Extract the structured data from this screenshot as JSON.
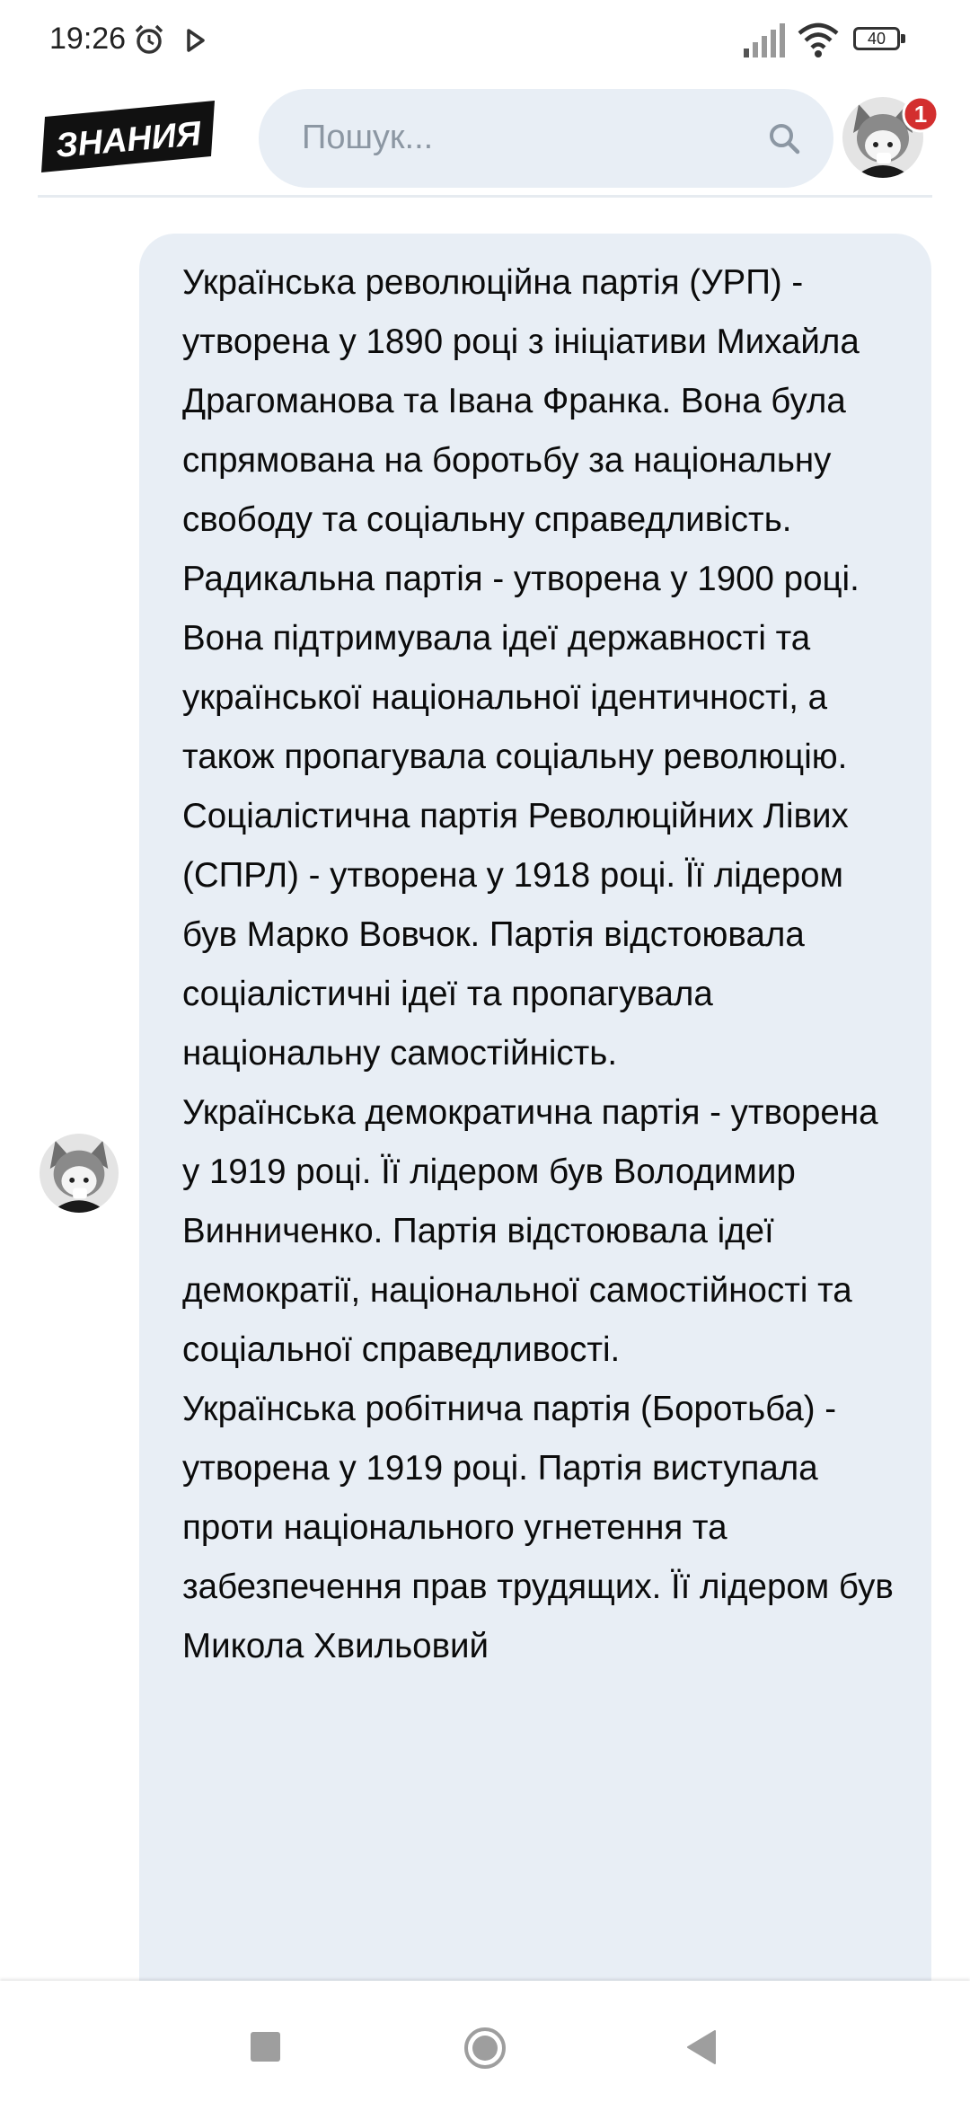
{
  "status_bar": {
    "time": "19:26",
    "battery": "40",
    "icons": [
      "alarm-icon",
      "play-icon",
      "signal-icon",
      "wifi-icon",
      "battery-icon"
    ]
  },
  "header": {
    "logo_text": "ЗНАНИЯ",
    "search": {
      "placeholder": "Пошук...",
      "value": ""
    },
    "notification_count": "1"
  },
  "colors": {
    "bubble_bg": "#e8eef5",
    "badge": "#d32f2f",
    "logo_bg": "#111111"
  },
  "message": {
    "paragraphs": [
      "Українська революційна партія (УРП) - утворена у 1890 році з ініціативи Михайла Драгоманова та Івана Франка. Вона була спрямована на боротьбу за національну свободу та соціальну справедливість.",
      "Радикальна партія - утворена у 1900 році. Вона підтримувала ідеї державності та української національної ідентичності, а також пропагувала соціальну революцію.",
      "Соціалістична партія Революційних Лівих (СПРЛ) - утворена у 1918 році. Її лідером був Марко Вовчок. Партія відстоювала соціалістичні ідеї та пропагувала національну самостійність.",
      "Українська демократична партія - утворена у 1919 році. Її лідером був Володимир Винниченко. Партія відстоювала ідеї демократії, національної самостійності та соціальної справедливості.",
      "Українська робітнича партія (Боротьба) - утворена у 1919 році. Партія виступала проти національного угнетення та забезпечення прав трудящих. Її лідером був Микола Хвильовий"
    ]
  }
}
